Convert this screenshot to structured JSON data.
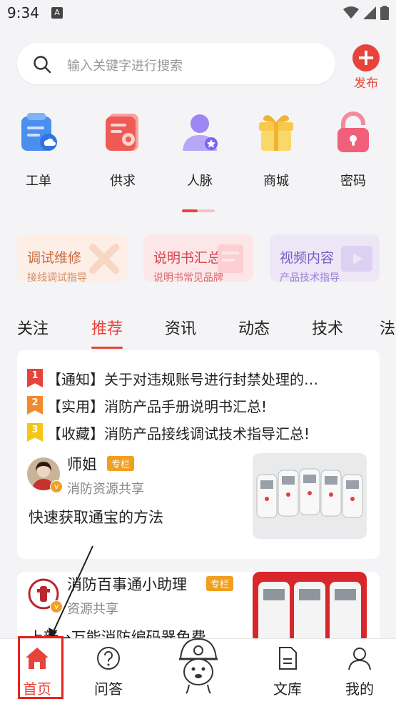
{
  "status_bar": {
    "time": "9:34",
    "a_label": "A"
  },
  "search": {
    "placeholder": "输入关键字进行搜索"
  },
  "publish": {
    "label": "发布"
  },
  "categories": [
    {
      "label": "工单",
      "icon": "work-order-icon"
    },
    {
      "label": "供求",
      "icon": "supply-demand-icon"
    },
    {
      "label": "人脉",
      "icon": "contacts-icon"
    },
    {
      "label": "商城",
      "icon": "gift-icon"
    },
    {
      "label": "密码",
      "icon": "lock-icon"
    }
  ],
  "promo_cards": [
    {
      "title": "调试维修",
      "subtitle": "接线调试指导"
    },
    {
      "title": "说明书汇总",
      "subtitle": "说明书常见品牌"
    },
    {
      "title": "视频内容",
      "subtitle": "产品技术指导"
    }
  ],
  "tabs": [
    "关注",
    "推荐",
    "资讯",
    "动态",
    "技术",
    "法"
  ],
  "active_tab": "推荐",
  "notices": [
    {
      "rank": "1",
      "text": "【通知】关于对违规账号进行封禁处理的…"
    },
    {
      "rank": "2",
      "text": "【实用】消防产品手册说明书汇总!"
    },
    {
      "rank": "3",
      "text": "【收藏】消防产品接线调试技术指导汇总!"
    }
  ],
  "post1": {
    "author": "师姐",
    "tag": "专栏",
    "subtitle": "消防资源共享",
    "title": "快速获取通宝的方法",
    "verified": "v"
  },
  "post2": {
    "author": "消防百事通小助理",
    "tag": "专栏",
    "subtitle": "资源共享",
    "title": "上新→万能消防编码器免费",
    "verified": "v"
  },
  "bottom_nav": [
    {
      "label": "首页",
      "icon": "home-icon"
    },
    {
      "label": "问答",
      "icon": "question-icon"
    },
    {
      "label": "",
      "icon": "mascot-icon"
    },
    {
      "label": "文库",
      "icon": "document-icon"
    },
    {
      "label": "我的",
      "icon": "profile-icon"
    }
  ],
  "colors": {
    "accent": "#e8433a",
    "tag": "#f0a020",
    "background": "#f4f4f6"
  }
}
